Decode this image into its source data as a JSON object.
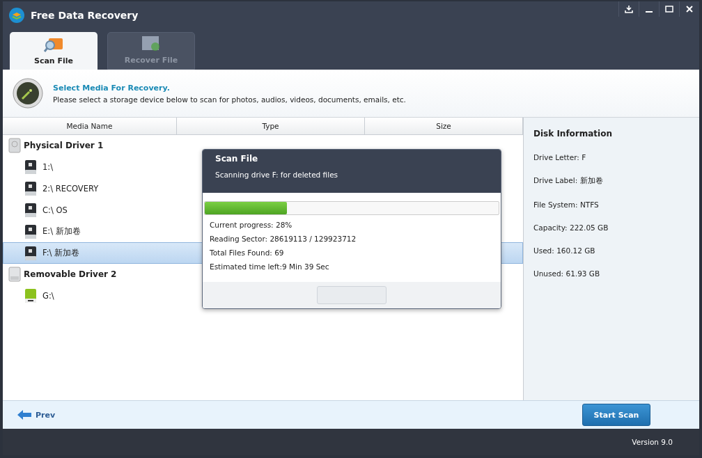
{
  "window": {
    "title": "Free Data Recovery"
  },
  "tabs": [
    {
      "label": "Scan File",
      "selected": true
    },
    {
      "label": "Recover File",
      "selected": false
    }
  ],
  "header": {
    "title": "Select Media For Recovery.",
    "description": "Please select a storage device below to scan for photos, audios, videos, documents, emails, etc."
  },
  "table": {
    "columns": [
      "Media Name",
      "Type",
      "Size"
    ],
    "groups": [
      {
        "label": "Physical Driver 1",
        "kind": "physical",
        "children": [
          {
            "label": "1:\\",
            "kind": "system",
            "selected": false
          },
          {
            "label": "2:\\ RECOVERY",
            "kind": "system",
            "selected": false
          },
          {
            "label": "C:\\ OS",
            "kind": "system",
            "selected": false
          },
          {
            "label": "E:\\ 新加卷",
            "kind": "system",
            "selected": false
          },
          {
            "label": "F:\\ 新加卷",
            "kind": "system",
            "selected": true
          }
        ]
      },
      {
        "label": "Removable Driver 2",
        "kind": "removable",
        "children": [
          {
            "label": "G:\\",
            "kind": "usb",
            "selected": false
          }
        ]
      }
    ]
  },
  "disk_info": {
    "title": "Disk Information",
    "lines": [
      "Drive Letter: F",
      "Drive Label: 新加卷",
      "File System: NTFS",
      "Capacity: 222.05 GB",
      "Used: 160.12 GB",
      "Unused: 61.93 GB"
    ]
  },
  "scan_dialog": {
    "title": "Scan File",
    "subtitle": "Scanning drive F: for deleted files",
    "level": 0.28,
    "lines": [
      "Current progress: 28%",
      "Reading Sector: 28619113 / 129923712",
      "Total Files Found: 69",
      "Estimated time left:9 Min 39 Sec"
    ]
  },
  "footer": {
    "prev": "Prev",
    "start": "Start Scan"
  },
  "status_bar": {
    "version": "Version 9.0"
  }
}
